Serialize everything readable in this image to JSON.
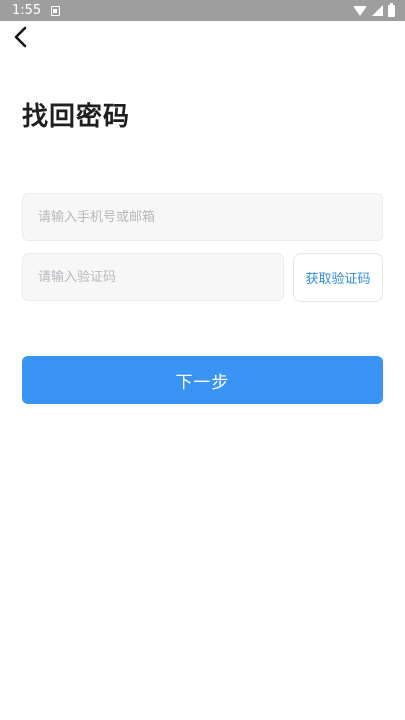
{
  "status_bar": {
    "time": "1:55",
    "icons": [
      "notification-icon",
      "wifi-icon",
      "signal-icon",
      "battery-icon"
    ]
  },
  "header": {
    "back_icon": "chevron-left-icon"
  },
  "page": {
    "title": "找回密码"
  },
  "form": {
    "account_placeholder": "请输入手机号或邮箱",
    "code_placeholder": "请输入验证码",
    "get_code_label": "获取验证码",
    "next_label": "下一步"
  },
  "colors": {
    "primary": "#3a94f5",
    "link": "#2f8fe8",
    "input_bg": "#f7f7f8",
    "status_bar": "#9e9e9e"
  }
}
